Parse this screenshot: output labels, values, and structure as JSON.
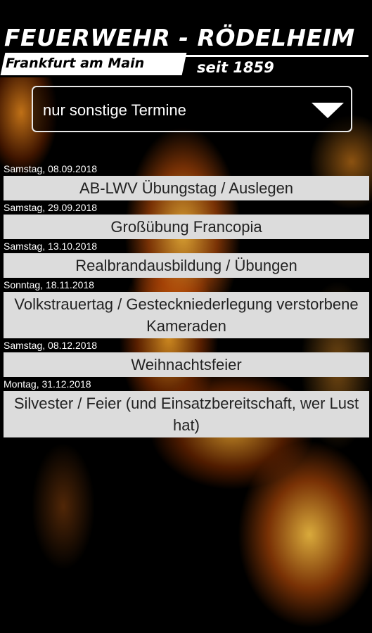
{
  "header": {
    "logo_title": "FEUERWEHR - RÖDELHEIM",
    "logo_subtitle": "Frankfurt am Main",
    "logo_since": "seit 1859"
  },
  "filter": {
    "selected": "nur sonstige Termine"
  },
  "events": [
    {
      "date": "Samstag, 08.09.2018",
      "title": "AB-LWV Übungstag / Auslegen"
    },
    {
      "date": "Samstag, 29.09.2018",
      "title": "Großübung Francopia"
    },
    {
      "date": "Samstag, 13.10.2018",
      "title": "Realbrandausbildung / Übungen"
    },
    {
      "date": "Sonntag, 18.11.2018",
      "title": "Volkstrauertag / Gesteckniederlegung verstorbene Kameraden"
    },
    {
      "date": "Samstag, 08.12.2018",
      "title": "Weihnachtsfeier"
    },
    {
      "date": "Montag, 31.12.2018",
      "title": "Silvester / Feier (und Einsatzbereitschaft, wer Lust hat)"
    }
  ],
  "colors": {
    "background": "#000000",
    "event_bg": "#dcdcdc",
    "event_text": "#222222",
    "accent_fire": "#ff9a1e"
  }
}
